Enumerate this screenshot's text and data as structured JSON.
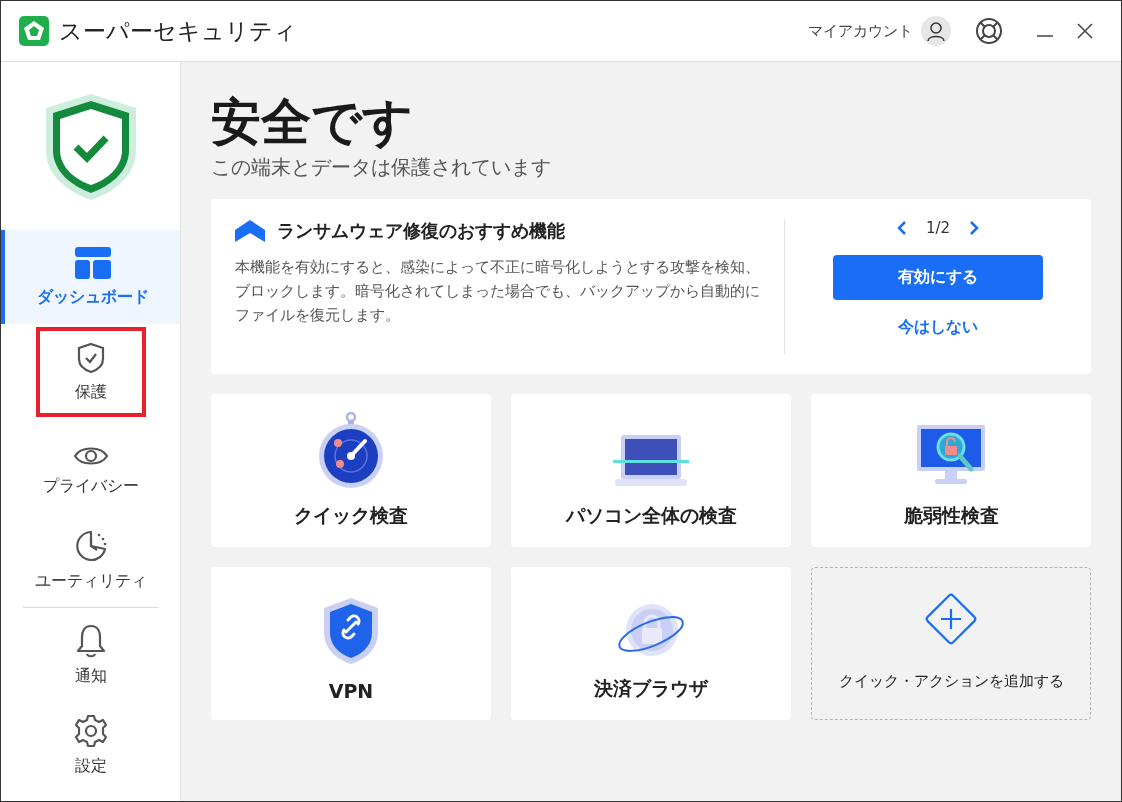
{
  "window": {
    "title": "スーパーセキュリティ",
    "account_label": "マイアカウント"
  },
  "sidebar": {
    "items": [
      {
        "label": "ダッシュボード",
        "selected": true,
        "highlighted": false
      },
      {
        "label": "保護",
        "selected": false,
        "highlighted": true
      },
      {
        "label": "プライバシー",
        "selected": false,
        "highlighted": false
      },
      {
        "label": "ユーティリティ",
        "selected": false,
        "highlighted": false
      },
      {
        "label": "通知",
        "selected": false,
        "highlighted": false
      },
      {
        "label": "設定",
        "selected": false,
        "highlighted": false
      }
    ]
  },
  "status": {
    "title": "安全です",
    "subtitle": "この端末とデータは保護されています"
  },
  "banner": {
    "title": "ランサムウェア修復のおすすめ機能",
    "body": "本機能を有効にすると、感染によって不正に暗号化しようとする攻撃を検知、ブロックします。暗号化されてしまった場合でも、バックアップから自動的にファイルを復元します。",
    "pager": "1/2",
    "primary_button": "有効にする",
    "secondary_link": "今はしない"
  },
  "tiles": [
    {
      "kind": "action",
      "label": "クイック検査"
    },
    {
      "kind": "action",
      "label": "パソコン全体の検査"
    },
    {
      "kind": "action",
      "label": "脆弱性検査"
    },
    {
      "kind": "action",
      "label": "VPN"
    },
    {
      "kind": "action",
      "label": "決済ブラウザ"
    },
    {
      "kind": "add",
      "label": "クイック・アクションを追加する"
    }
  ]
}
